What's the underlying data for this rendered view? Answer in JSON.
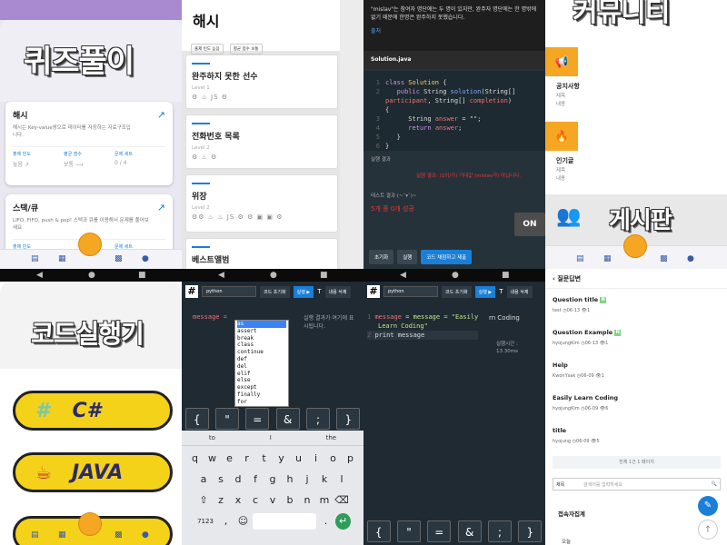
{
  "panel1": {
    "title": "퀴즈풀이",
    "cards": [
      {
        "title": "해시",
        "desc": "해시는 Key-value쌍으로 데이터를 저장하는 자료구조입니다.",
        "stat_labels": [
          "출제 빈도",
          "평균 점수",
          "문제 세트"
        ],
        "stat_values": [
          "높음 ↗",
          "보통 ⟶",
          "0 / 4"
        ]
      },
      {
        "title": "스택/큐",
        "desc": "LIFO, FIFO, push & pop! 스택과 큐를 이용해서 문제를 풀어보세요.",
        "stat_labels": [
          "출제 빈도",
          "",
          "문제 세트"
        ],
        "stat_values": [
          "",
          "",
          ""
        ]
      }
    ]
  },
  "panel2": {
    "title": "해시",
    "chips": [
      "출제 빈도 높음",
      "평균 점수 보통"
    ],
    "items": [
      {
        "title": "완주하지 못한 선수",
        "level": "Level 1",
        "icons": "⚙ ♨ JS ⚙"
      },
      {
        "title": "전화번호 목록",
        "level": "Level 2",
        "icons": "⚙ ♨ ⚙"
      },
      {
        "title": "위장",
        "level": "Level 2",
        "icons": "⚙⚙ ♨ ♨ JS ⚙ ⚙ ▣ ▣ ⚙"
      },
      {
        "title": "베스트앨범",
        "level": "",
        "icons": ""
      }
    ]
  },
  "panel3": {
    "top_line1": "\"mislav\"는 참여자 명단에는 두 명이 있지만, 완주자 명단에는 한 명밖에 없기 때문에 한명은 완주하지 못했습니다.",
    "top_link": "출처",
    "filename": "Solution.java",
    "code_lines": [
      "class Solution {",
      "public String solution(String[]",
      "participant, String[] completion)",
      "{",
      "String answer = \"\";",
      "return answer;",
      "}",
      "}"
    ],
    "line_numbers": [
      "1",
      "2",
      "",
      "",
      "3",
      "4",
      "5",
      "6"
    ],
    "result_label": "실행 결과",
    "result_error": "실행 결과: (1이/가) 기대값 (mislav가) 아닙니다.",
    "test_label": "테스트 결과 (~˘▾˘)~",
    "score": "5개 중 0개 성공",
    "on_button": "ON",
    "buttons": [
      "초기화",
      "실행",
      "코드 채점하고 제출"
    ]
  },
  "panel4": {
    "title": "커뮤니티",
    "sections": [
      {
        "title": "공지사항",
        "lines": [
          "제목",
          "내용"
        ],
        "icon": "📢"
      },
      {
        "title": "인기글",
        "lines": [
          "제목",
          "내용"
        ],
        "icon": "🔥"
      }
    ],
    "board_title": "게시판"
  },
  "panel5": {
    "title": "코드실행기",
    "langs": [
      "C#",
      "JAVA"
    ]
  },
  "panel6": {
    "lang": "python",
    "btn_reset": "코드 초기화",
    "btn_run": "실행 ▶",
    "btn_t": "T",
    "btn_content": "내용 삭제",
    "code": "message =",
    "output": "실행 결과가 여기에 표시됩니다.",
    "autocomplete": [
      "as",
      "assert",
      "break",
      "class",
      "continue",
      "def",
      "del",
      "elif",
      "else",
      "except",
      "finally",
      "for"
    ],
    "symbols": [
      "{",
      "\"",
      "=",
      "&",
      ";",
      "}"
    ],
    "suggestions": [
      "to",
      "I",
      "the"
    ],
    "kb_row1": [
      "q",
      "w",
      "e",
      "r",
      "t",
      "y",
      "u",
      "i",
      "o",
      "p"
    ],
    "kb_row2": [
      "a",
      "s",
      "d",
      "f",
      "g",
      "h",
      "j",
      "k",
      "l"
    ],
    "kb_row3": [
      "z",
      "x",
      "c",
      "v",
      "b",
      "n",
      "m"
    ],
    "kb_bottom": [
      "7123",
      ",",
      "☺",
      "",
      ".",
      "↵"
    ]
  },
  "panel7": {
    "lang": "python",
    "btn_reset": "코드 초기화",
    "btn_run": "실행 ▶",
    "btn_t": "T",
    "btn_content": "내용 삭제",
    "code_line1": "message = \"Easily",
    "code_line1b": "Learn Coding\"",
    "code_line2": "print message",
    "output": "rn Coding",
    "time_label": "실행시간 :",
    "time_value": "13.30ms",
    "symbols": [
      "{",
      "\"",
      "=",
      "&",
      ";",
      "}"
    ]
  },
  "panel8": {
    "back": "질문답변",
    "questions": [
      {
        "title": "Question title",
        "user": "test",
        "date": "06-13",
        "views": "1",
        "badge": true
      },
      {
        "title": "Question Example",
        "user": "hyojungKim",
        "date": "06-13",
        "views": "1",
        "badge": true
      },
      {
        "title": "Help",
        "user": "KwonYsak",
        "date": "06-09",
        "views": "1",
        "badge": false
      },
      {
        "title": "Easily Learn Coding",
        "user": "hyojungKim",
        "date": "06-09",
        "views": "6",
        "badge": false
      },
      {
        "title": "title",
        "user": "hyojung",
        "date": "06-09",
        "views": "5",
        "badge": false
      }
    ],
    "pager": "전체 1건 1 페이지",
    "search_field": "제목",
    "search_placeholder": "검색어를 입력하세요",
    "footer_title": "접속자집계",
    "footer_item": "오늘"
  }
}
